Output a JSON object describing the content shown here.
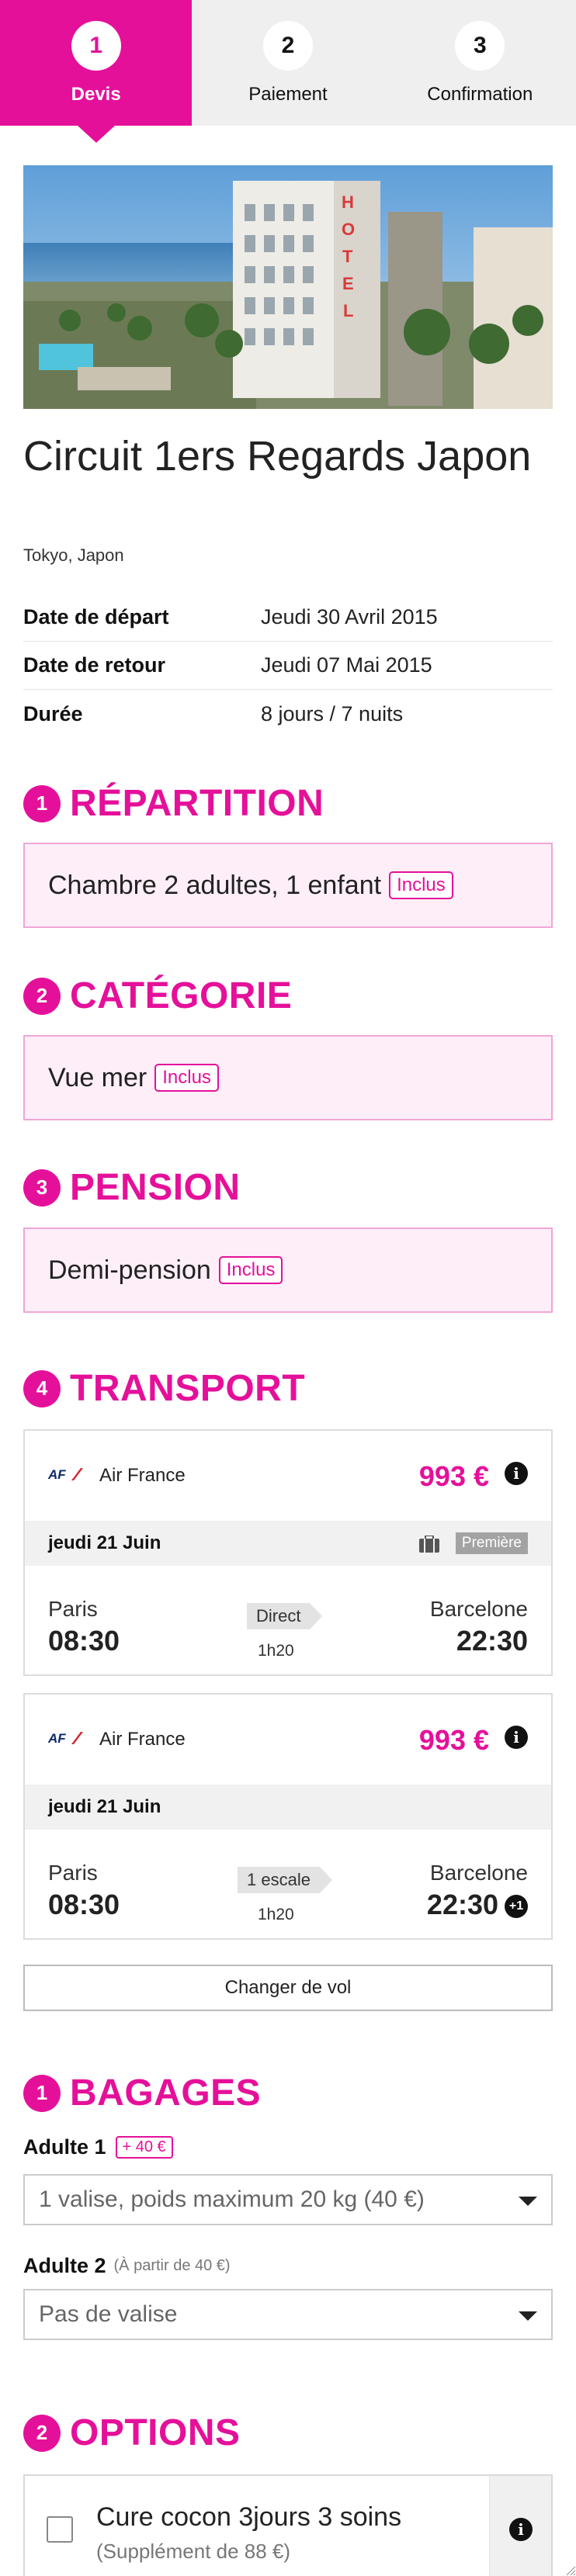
{
  "stepper": [
    {
      "number": "1",
      "label": "Devis",
      "active": true
    },
    {
      "number": "2",
      "label": "Paiement",
      "active": false
    },
    {
      "number": "3",
      "label": "Confirmation",
      "active": false
    }
  ],
  "hero": {
    "sign": "HOTEL"
  },
  "trip": {
    "title": "Circuit 1ers Regards Japon",
    "location": "Tokyo, Japon",
    "details": [
      {
        "label": "Date de départ",
        "value": "Jeudi 30 Avril 2015"
      },
      {
        "label": "Date de retour",
        "value": "Jeudi 07 Mai 2015"
      },
      {
        "label": "Durée",
        "value": "8 jours / 7 nuits"
      }
    ]
  },
  "sections": {
    "repartition": {
      "number": "1",
      "title": "RÉPARTITION",
      "value": "Chambre 2 adultes, 1 enfant",
      "tag": "Inclus"
    },
    "categorie": {
      "number": "2",
      "title": "CATÉGORIE",
      "value": "Vue mer",
      "tag": "Inclus"
    },
    "pension": {
      "number": "3",
      "title": "PENSION",
      "value": "Demi-pension",
      "tag": "Inclus"
    },
    "transport": {
      "number": "4",
      "title": "TRANSPORT"
    },
    "bagages": {
      "number": "1",
      "title": "BAGAGES"
    },
    "options": {
      "number": "2",
      "title": "OPTIONS"
    }
  },
  "flights": [
    {
      "airline": "Air France",
      "price": "993 €",
      "date": "jeudi 21 Juin",
      "cabin": "Première",
      "from_city": "Paris",
      "from_time": "08:30",
      "stops": "Direct",
      "duration": "1h20",
      "to_city": "Barcelone",
      "to_time": "22:30"
    },
    {
      "airline": "Air France",
      "price": "993 €",
      "date": "jeudi 21 Juin",
      "from_city": "Paris",
      "from_time": "08:30",
      "stops": "1 escale",
      "duration": "1h20",
      "to_city": "Barcelone",
      "to_time": "22:30",
      "day_offset": "+1"
    }
  ],
  "change_flight_label": "Changer de vol",
  "baggage": [
    {
      "label": "Adulte 1",
      "extra": "+ 40 €",
      "selected": "1 valise, poids maximum 20 kg (40 €)"
    },
    {
      "label": "Adulte 2",
      "note": "(À partir de 40 €)",
      "selected": "Pas de valise"
    }
  ],
  "option": {
    "title": "Cure cocon 3jours 3 soins",
    "subtitle": "(Supplément de 88 €)",
    "checked": false
  },
  "colors": {
    "accent": "#e5109a",
    "tag_bg": "#fdeef8",
    "band": "#f1f1f1"
  }
}
